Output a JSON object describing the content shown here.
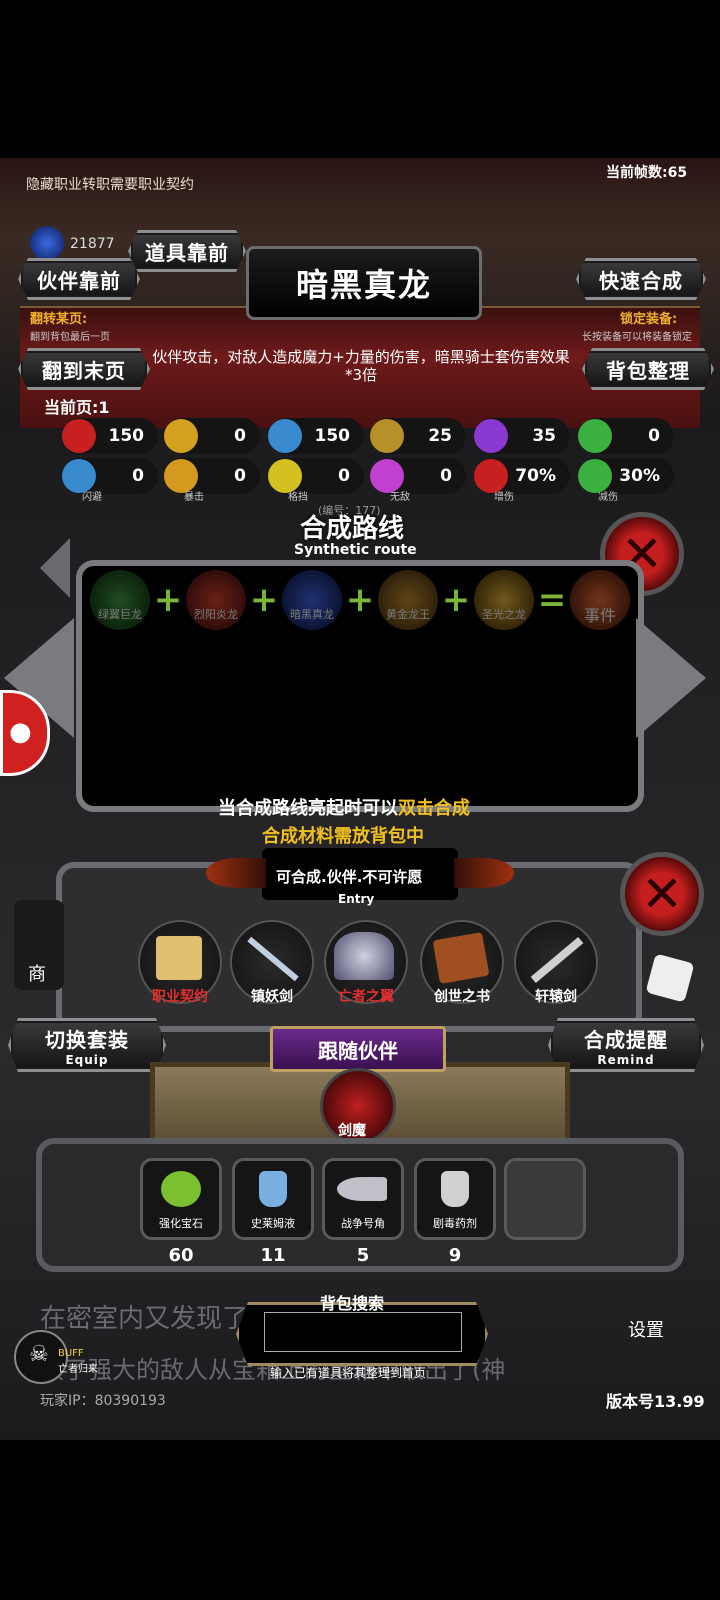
{
  "hud": {
    "hint": "隐藏职业转职需要职业契约",
    "fps": "当前帧数:65",
    "gems": "21877"
  },
  "top_buttons": {
    "props_first": "道具靠前",
    "partner_first": "伙伴靠前",
    "quick_merge": "快速合成",
    "to_last_page": "翻到末页",
    "bag_sort": "背包整理"
  },
  "title": "暗黑真龙",
  "flip_page": {
    "label": "翻转某页:",
    "sub": "翻到背包最后一页"
  },
  "lock_equip": {
    "label": "锁定装备:",
    "sub": "长按装备可以将装备锁定"
  },
  "description": "伙伴攻击，对敌人造成魔力+力量的伤害，暗黑骑士套伤害效果*3倍",
  "current_page": "当前页:1",
  "stats_row1": [
    {
      "icon": "heart-icon",
      "value": "150",
      "color": "#c82020"
    },
    {
      "icon": "strength-icon",
      "value": "0",
      "color": "#d4a020"
    },
    {
      "icon": "helmet-icon",
      "value": "150",
      "color": "#3a8ad0"
    },
    {
      "icon": "sword-icon",
      "value": "25",
      "color": "#b8902a"
    },
    {
      "icon": "lightning-icon",
      "value": "35",
      "color": "#8a3ad0"
    },
    {
      "icon": "clover-icon",
      "value": "0",
      "color": "#3ab040"
    }
  ],
  "stats_row2": [
    {
      "icon": "dodge-icon",
      "value": "0",
      "label": "闪避",
      "color": "#3a8ad0"
    },
    {
      "icon": "crit-icon",
      "value": "0",
      "label": "暴击",
      "color": "#d49a20"
    },
    {
      "icon": "block-icon",
      "value": "0",
      "label": "格挡",
      "color": "#d4c020"
    },
    {
      "icon": "invincible-icon",
      "value": "0",
      "label": "无敌",
      "color": "#c040d0"
    },
    {
      "icon": "damage-up-icon",
      "value": "70%",
      "label": "增伤",
      "color": "#c82020"
    },
    {
      "icon": "damage-reduce-icon",
      "value": "30%",
      "label": "减伤",
      "color": "#3ab040"
    }
  ],
  "synthetic": {
    "title": "合成路线",
    "subtitle": "Synthetic route",
    "number": "(编号：177)",
    "dragons": [
      "绿翼巨龙",
      "烈阳炎龙",
      "暗黑真龙",
      "黄金龙王",
      "圣光之龙"
    ],
    "result": "事件",
    "hint1a": "当合成路线亮起时可以",
    "hint1b": "双击合成",
    "hint2": "合成材料需放背包中"
  },
  "entry": {
    "title": "可合成.伙伴.不可许愿",
    "sub": "Entry"
  },
  "entry_items": [
    {
      "label": "职业契约",
      "color": "#e03030"
    },
    {
      "label": "镇妖剑",
      "color": "#ffffff"
    },
    {
      "label": "亡者之翼",
      "color": "#e03030"
    },
    {
      "label": "创世之书",
      "color": "#ffffff"
    },
    {
      "label": "轩辕剑",
      "color": "#ffffff"
    }
  ],
  "switch_set": {
    "label": "切换套装",
    "sub": "Equip"
  },
  "merge_remind": {
    "label": "合成提醒",
    "sub": "Remind"
  },
  "follow_partner": {
    "title": "跟随伙伴",
    "name": "剑魔"
  },
  "inventory": [
    {
      "label": "强化宝石",
      "count": "60"
    },
    {
      "label": "史莱姆液",
      "count": "11"
    },
    {
      "label": "战争号角",
      "count": "5"
    },
    {
      "label": "剧毒药剂",
      "count": "9"
    }
  ],
  "bag_search": {
    "title": "背包搜索",
    "hint": "输入已有道具将其整理到首页",
    "value": ""
  },
  "side": {
    "shop": "商",
    "settings": "设置"
  },
  "buff": {
    "label": "BUFF",
    "sub": "亡者归来"
  },
  "log_text1": "在密室内又发现了",
  "log_text2": "败了强大的敌人从宝箱上的宝箱中取出了(神",
  "player_ip": "玩家IP：80390193",
  "version": "版本号13.99"
}
